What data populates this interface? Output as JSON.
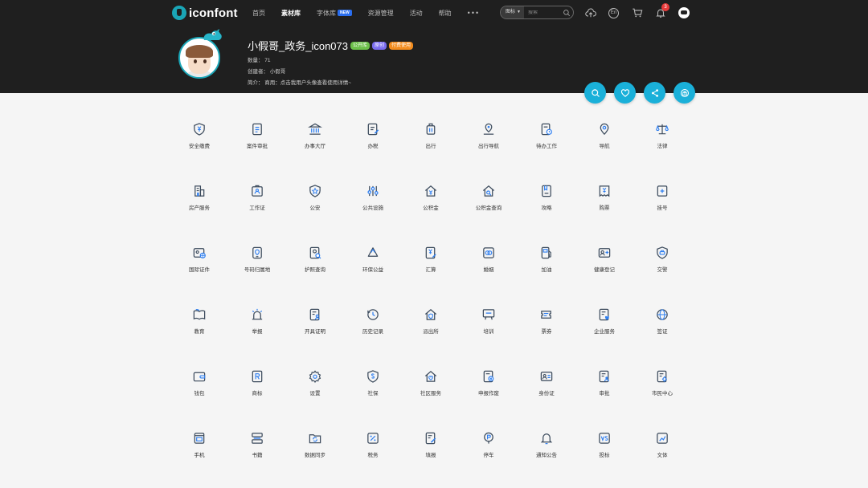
{
  "nav": {
    "logo_text": "iconfont",
    "items": [
      "首页",
      "素材库",
      "字体库",
      "资源管理",
      "活动",
      "帮助"
    ],
    "active_index": 1,
    "new_badge": "NEW",
    "more": "•••"
  },
  "search": {
    "scope": "图标",
    "placeholder": "搜索"
  },
  "toolbar": {
    "lang": "En",
    "notification_count": "3"
  },
  "project": {
    "title": "小假哥_政务_icon073",
    "tags": [
      {
        "label": "公开库",
        "color": "#6cc04a"
      },
      {
        "label": "原创",
        "color": "#7b6cf0"
      },
      {
        "label": "付费使用",
        "color": "#f28c1e"
      }
    ],
    "count": "数量： 71",
    "creator": "创建者： 小假哥",
    "intro": "简介： 商用：点击我用户头像查看使用详情~"
  },
  "actions": [
    "search-icon",
    "heart-icon",
    "share-icon",
    "gift-icon"
  ],
  "accent": "#1ab0d9",
  "icons": [
    {
      "label": "安全缴费",
      "glyph": "shield-yen"
    },
    {
      "label": "案件审批",
      "glyph": "doc"
    },
    {
      "label": "办事大厅",
      "glyph": "hall"
    },
    {
      "label": "办税",
      "glyph": "doc-pen"
    },
    {
      "label": "出行",
      "glyph": "luggage"
    },
    {
      "label": "出行导航",
      "glyph": "pin"
    },
    {
      "label": "待办工作",
      "glyph": "doc-clock"
    },
    {
      "label": "导航",
      "glyph": "pin2"
    },
    {
      "label": "法律",
      "glyph": "scale"
    },
    {
      "label": "房产服务",
      "glyph": "building"
    },
    {
      "label": "工作证",
      "glyph": "badge"
    },
    {
      "label": "公安",
      "glyph": "shield-star"
    },
    {
      "label": "公共设施",
      "glyph": "sliders"
    },
    {
      "label": "公积金",
      "glyph": "house-yen"
    },
    {
      "label": "公积金查询",
      "glyph": "house-search"
    },
    {
      "label": "攻略",
      "glyph": "book"
    },
    {
      "label": "购票",
      "glyph": "ticket-yen"
    },
    {
      "label": "挂号",
      "glyph": "doc-plus"
    },
    {
      "label": "国际证件",
      "glyph": "id-globe"
    },
    {
      "label": "号码归属地",
      "glyph": "phone-pin"
    },
    {
      "label": "护照查询",
      "glyph": "passport-search"
    },
    {
      "label": "环保公益",
      "glyph": "recycle"
    },
    {
      "label": "汇算",
      "glyph": "doc-yen"
    },
    {
      "label": "婚姻",
      "glyph": "rings"
    },
    {
      "label": "加油",
      "glyph": "fuel"
    },
    {
      "label": "健康登记",
      "glyph": "id-plus"
    },
    {
      "label": "交警",
      "glyph": "shield-car"
    },
    {
      "label": "教育",
      "glyph": "book-open"
    },
    {
      "label": "举报",
      "glyph": "alarm"
    },
    {
      "label": "开具证明",
      "glyph": "doc-person"
    },
    {
      "label": "历史记录",
      "glyph": "history"
    },
    {
      "label": "派出所",
      "glyph": "house-shield"
    },
    {
      "label": "培训",
      "glyph": "board"
    },
    {
      "label": "票券",
      "glyph": "tickets"
    },
    {
      "label": "企业服务",
      "glyph": "doc-heart"
    },
    {
      "label": "签证",
      "glyph": "globe"
    },
    {
      "label": "钱包",
      "glyph": "wallet"
    },
    {
      "label": "商标",
      "glyph": "r-mark"
    },
    {
      "label": "设置",
      "glyph": "gear"
    },
    {
      "label": "社保",
      "glyph": "shield-s"
    },
    {
      "label": "社区服务",
      "glyph": "house-heart"
    },
    {
      "label": "申报作废",
      "glyph": "doc-x"
    },
    {
      "label": "身份证",
      "glyph": "id-card"
    },
    {
      "label": "审批",
      "glyph": "doc-check-person"
    },
    {
      "label": "市民中心",
      "glyph": "doc-person2"
    },
    {
      "label": "手机",
      "glyph": "tablet"
    },
    {
      "label": "书籍",
      "glyph": "books"
    },
    {
      "label": "数据同步",
      "glyph": "folder-sync"
    },
    {
      "label": "税务",
      "glyph": "percent"
    },
    {
      "label": "填报",
      "glyph": "doc-edit"
    },
    {
      "label": "停车",
      "glyph": "parking"
    },
    {
      "label": "通知公告",
      "glyph": "bell"
    },
    {
      "label": "投标",
      "glyph": "vs"
    },
    {
      "label": "文体",
      "glyph": "doc-ball"
    }
  ]
}
